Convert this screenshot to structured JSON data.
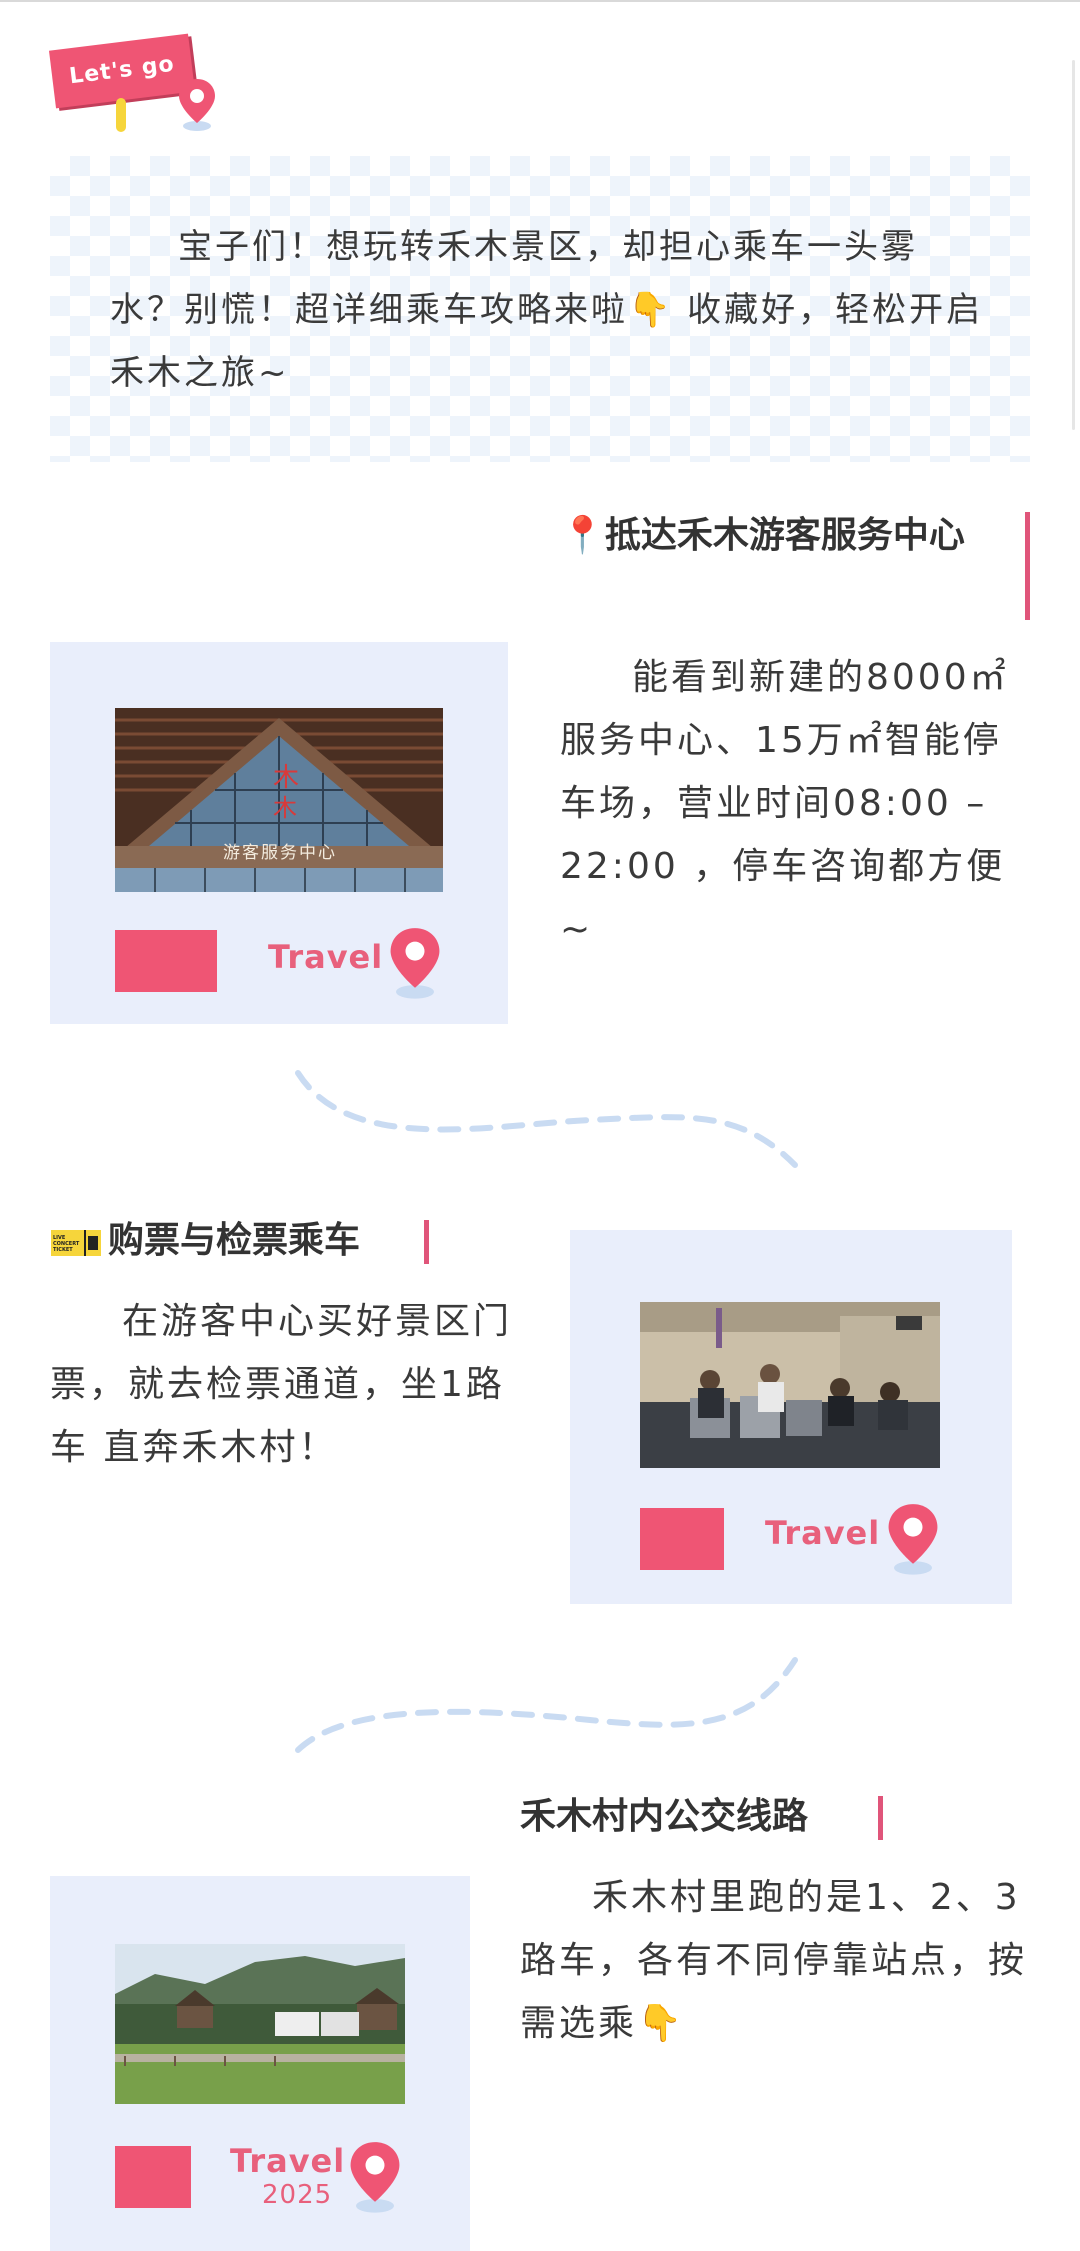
{
  "colors": {
    "accent": "#ef5574",
    "card_bg": "#e9eefb",
    "wave": "#c9dbf2",
    "badge": "#f6d53b"
  },
  "tag": {
    "label": "Let's go",
    "icon": "map-pin-icon"
  },
  "intro": {
    "text": "宝子们！想玩转禾木景区，却担心乘车一头雾水？别慌！超详细乘车攻略来啦👇 收藏好，轻松开启禾木之旅~"
  },
  "sections": [
    {
      "heading": "📍抵达禾木游客服务中心",
      "text": "能看到新建的8000㎡服务中心、15万㎡智能停车场，营业时间08:00 – 22:00 ，停车咨询都方便~",
      "photo_sign": "游客服务中心",
      "travel_label": "Travel"
    },
    {
      "heading": "购票与检票乘车",
      "heading_icon": "ticket-icon",
      "ticket_icon_text": "LIVE CONCERT TICKET",
      "text": "在游客中心买好景区门票，就去检票通道，坐1路车 直奔禾木村！",
      "travel_label": "Travel"
    },
    {
      "heading": "禾木村内公交线路",
      "text": "禾木村里跑的是1、2、3路车，各有不同停靠站点，按需选乘👇",
      "travel_label": "Travel",
      "year": "2025"
    }
  ]
}
